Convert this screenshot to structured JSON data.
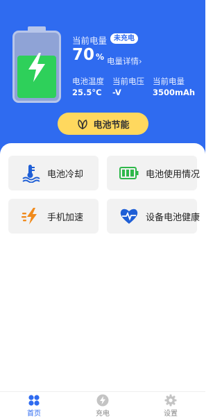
{
  "battery_panel": {
    "title": "当前电量",
    "charging_badge": "未充电",
    "percent_value": "70",
    "percent_sign": "%",
    "detail_link": "电量详情›",
    "level_fraction": 0.7,
    "stats": [
      {
        "label": "电池温度",
        "value": "25.5°C"
      },
      {
        "label": "当前电压",
        "value": "-V"
      },
      {
        "label": "当前电量",
        "value": "3500mAh"
      }
    ]
  },
  "save_button": {
    "label": "电池节能",
    "icon": "leaf-icon"
  },
  "feature_cards": [
    {
      "label": "电池冷却",
      "icon": "thermometer-water-icon"
    },
    {
      "label": "电池使用情况",
      "icon": "battery-bars-icon"
    },
    {
      "label": "手机加速",
      "icon": "lightning-speed-icon"
    },
    {
      "label": "设备电池健康",
      "icon": "heart-pulse-icon"
    }
  ],
  "tabbar": {
    "items": [
      {
        "label": "首页",
        "icon": "home-grid-icon",
        "active": true
      },
      {
        "label": "充电",
        "icon": "charge-bolt-icon",
        "active": false
      },
      {
        "label": "设置",
        "icon": "gear-icon",
        "active": false
      }
    ]
  },
  "colors": {
    "primary": "#2f6bf0",
    "battery_fill": "#2ed05a",
    "button_yellow": "#ffd85e",
    "card_bg": "#f2f2f2"
  }
}
